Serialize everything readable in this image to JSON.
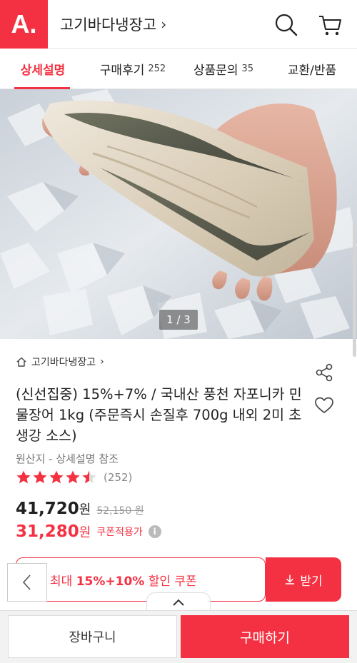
{
  "header": {
    "logo": "A.",
    "store_title": "고기바다냉장고",
    "title_chevron": "›",
    "search_icon": "search-icon",
    "cart_icon": "cart-icon"
  },
  "tabs": [
    {
      "label": "상세설명",
      "count": "",
      "active": true
    },
    {
      "label": "구매후기",
      "count": "252",
      "active": false
    },
    {
      "label": "상품문의",
      "count": "35",
      "active": false
    },
    {
      "label": "교환/반품",
      "count": "",
      "active": false
    }
  ],
  "gallery": {
    "pager": "1 / 3"
  },
  "product": {
    "breadcrumb": "고기바다냉장고",
    "breadcrumb_chevron": "›",
    "title": "(신선집중) 15%+7% / 국내산 풍천 자포니카 민물장어 1kg (주문즉시 손질후 700g 내외 2미 초생강 소스)",
    "origin": "원산지 - 상세설명 참조",
    "rating": 4.5,
    "rating_max": 5,
    "review_count": "(252)",
    "price": "41,720",
    "price_unit": "원",
    "original_price": "52,150 원",
    "coupon_price": "31,280",
    "coupon_unit": "원",
    "coupon_label": "쿠폰적용가",
    "info_icon_glyph": "i"
  },
  "coupon_bar": {
    "text_prefix": "최대 ",
    "text_bold": "15%+10%",
    "text_suffix": " 할인 쿠폰",
    "download_label": "받기"
  },
  "bottom": {
    "cart_label": "장바구니",
    "buy_label": "구매하기"
  },
  "colors": {
    "brand": "#f43142",
    "text": "#222222",
    "muted": "#888888"
  }
}
